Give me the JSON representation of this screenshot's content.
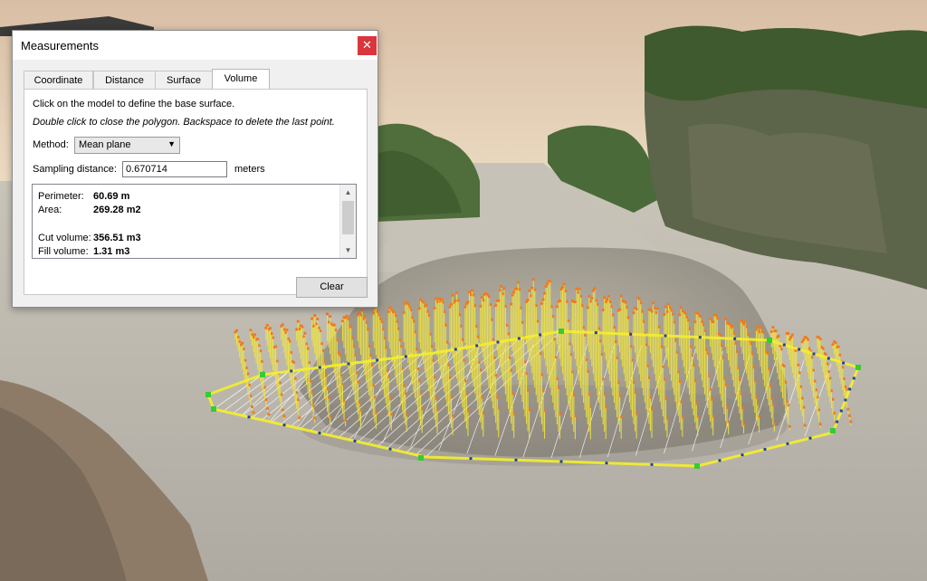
{
  "dialog": {
    "title": "Measurements",
    "close_glyph": "✕",
    "tabs": [
      {
        "label": "Coordinate"
      },
      {
        "label": "Distance"
      },
      {
        "label": "Surface"
      },
      {
        "label": "Volume",
        "active": true
      }
    ],
    "instruction_1": "Click on the model to define the base surface.",
    "instruction_2": "Double click to close the polygon. Backspace to delete the last point.",
    "method_label": "Method:",
    "method_value": "Mean plane",
    "sampling_label": "Sampling distance:",
    "sampling_value": "0.670714",
    "sampling_unit": "meters",
    "results": {
      "perimeter_label": "Perimeter:",
      "perimeter_value": "60.69 m",
      "area_label": "Area:",
      "area_value": "269.28 m2",
      "cut_label": "Cut volume:",
      "cut_value": "356.51 m3",
      "fill_label": "Fill volume:",
      "fill_value": "1.31 m3"
    },
    "clear_label": "Clear"
  },
  "scene": {
    "sky_top": "#d9c0a6",
    "sky_bottom": "#efe2c9",
    "ground_color": "#bcb8b0",
    "pile_color": "#a29d93",
    "vegetation_color": "#4e6a3a",
    "rock_color": "#5b6148",
    "stick_color": "#f2e83a",
    "dot_color": "#f07a1e",
    "vertex_color": "#33cc33",
    "blue_dot_color": "#1f3fae"
  }
}
